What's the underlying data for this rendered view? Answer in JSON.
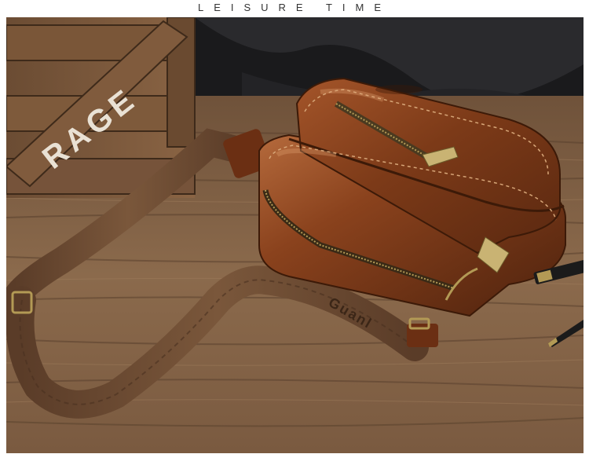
{
  "header": {
    "title": "LEISURE TIME"
  },
  "photo": {
    "crate_stencil_text": "RAGE",
    "strap_woven_text": "Guanl",
    "colors": {
      "wood_table": "#8a6a4c",
      "wood_dark": "#5e4531",
      "leather": "#7a3a1a",
      "leather_highlight": "#b2683a",
      "strap": "#6b4a33",
      "fabric_dark": "#1c1c1e",
      "metal_hardware": "#b39a55"
    }
  }
}
